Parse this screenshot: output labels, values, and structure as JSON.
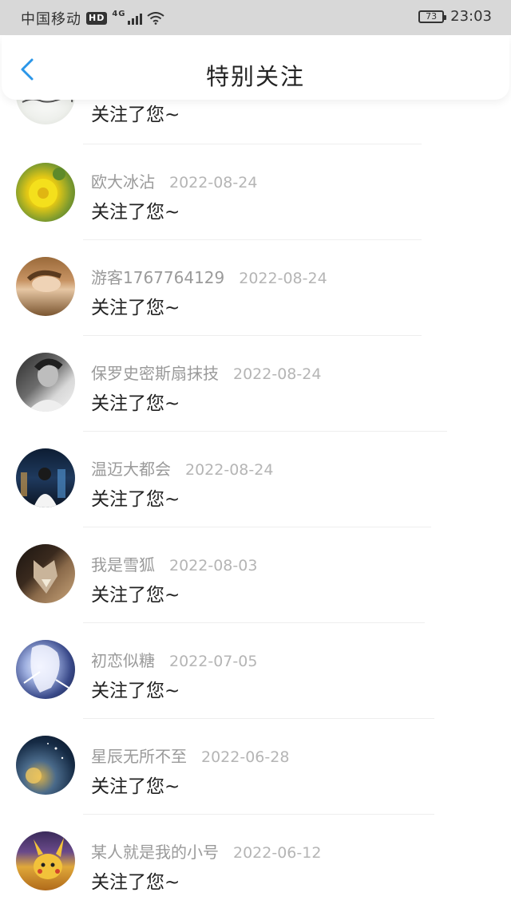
{
  "status_bar": {
    "carrier": "中国移动",
    "hd": "HD",
    "network": "4G",
    "battery": "73",
    "time": "23:03"
  },
  "header": {
    "title": "特别关注"
  },
  "items": [
    {
      "name": "",
      "date": "",
      "message": "关注了您~",
      "avatar": "calligraphy-avatar"
    },
    {
      "name": "欧大冰沾",
      "date": "2022-08-24",
      "message": "关注了您~",
      "avatar": "yellow-flower-avatar"
    },
    {
      "name": "游客1767764129",
      "date": "2022-08-24",
      "message": "关注了您~",
      "avatar": "girl-lying-avatar"
    },
    {
      "name": "保罗史密斯扇抹技",
      "date": "2022-08-24",
      "message": "关注了您~",
      "avatar": "bw-man-avatar"
    },
    {
      "name": "温迈大都会",
      "date": "2022-08-24",
      "message": "关注了您~",
      "avatar": "city-night-avatar"
    },
    {
      "name": "我是雪狐",
      "date": "2022-08-03",
      "message": "关注了您~",
      "avatar": "wolf-avatar"
    },
    {
      "name": "初恋似糖",
      "date": "2022-07-05",
      "message": "关注了您~",
      "avatar": "anime-girl-avatar"
    },
    {
      "name": "星辰无所不至",
      "date": "2022-06-28",
      "message": "关注了您~",
      "avatar": "starry-avatar"
    },
    {
      "name": "某人就是我的小号",
      "date": "2022-06-12",
      "message": "关注了您~",
      "avatar": "pikachu-avatar"
    }
  ]
}
